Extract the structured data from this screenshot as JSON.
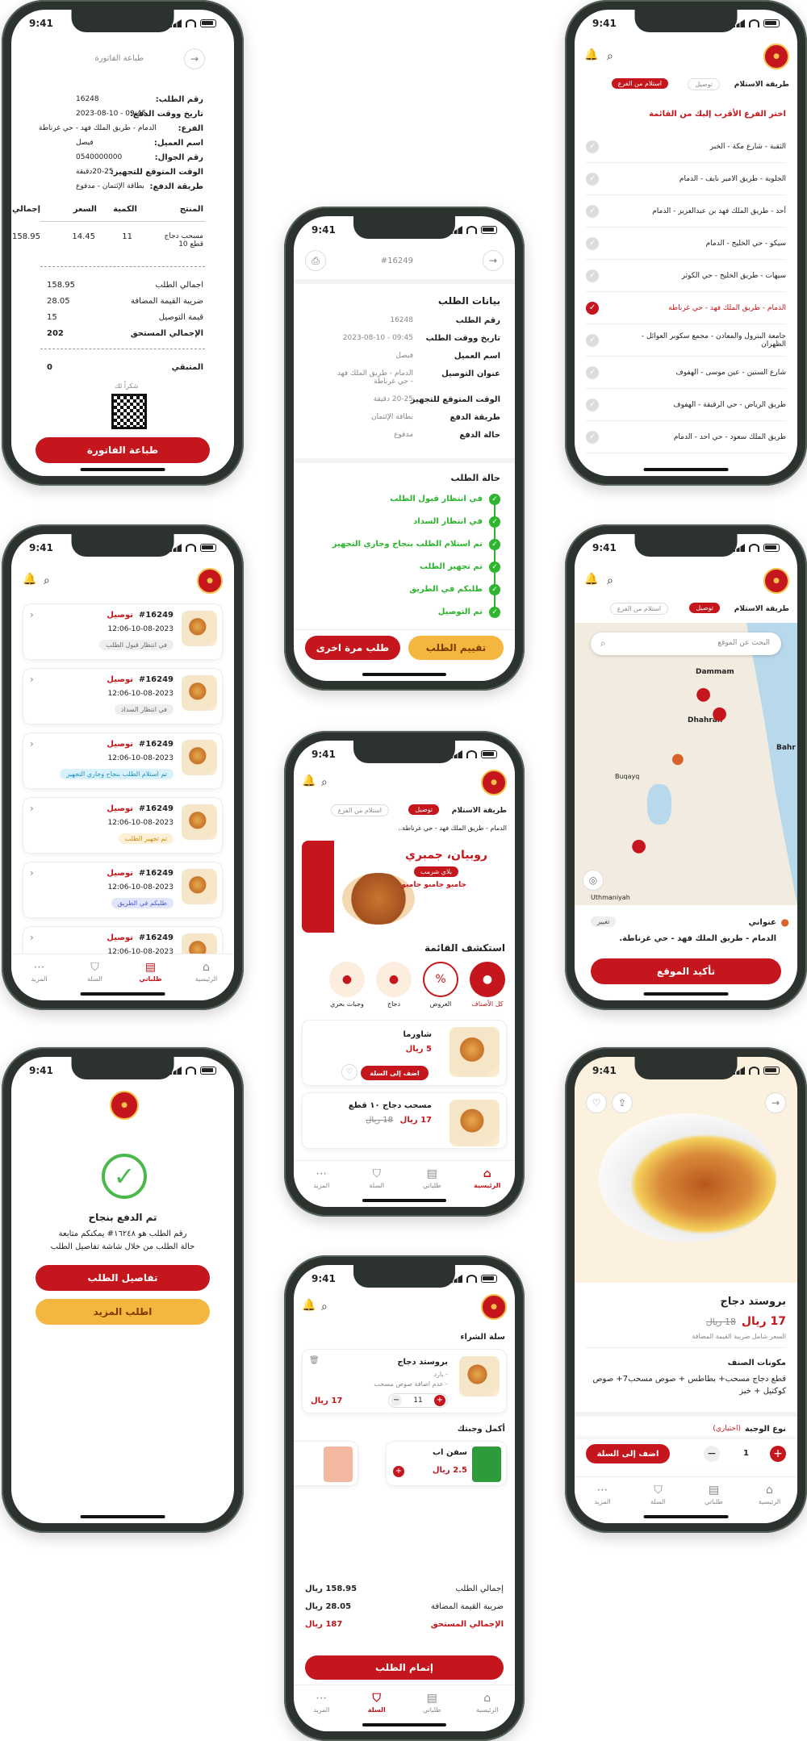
{
  "status": {
    "time": "9:41"
  },
  "invoice": {
    "title": "طباعة الفاتورة",
    "fields": [
      {
        "l": "رقم الطلب:",
        "v": "16248"
      },
      {
        "l": "تاريخ ووقت الدفع:",
        "v": "09:45 - 2023-08-10"
      },
      {
        "l": "الفرع:",
        "v": "الدمام - طريق الملك فهد - حي غرناطة"
      },
      {
        "l": "اسم العميل:",
        "v": "فيصل"
      },
      {
        "l": "رقم الجوال:",
        "v": "0540000000"
      },
      {
        "l": "الوقت المتوقع للتجهيز:",
        "v": "20-25دقيقة"
      },
      {
        "l": "طريقة الدفع:",
        "v": "بطاقة الإئتمان - مدفوع"
      }
    ],
    "cols": [
      "المنتج",
      "الكمية",
      "السعر",
      "إجمالي"
    ],
    "item": {
      "name": "مسحب دجاج قطع 10",
      "qty": "11",
      "price": "14.45",
      "total": "158.95"
    },
    "totals": [
      {
        "l": "اجمالي الطلب",
        "v": "158.95"
      },
      {
        "l": "ضريبة القيمة المضافة",
        "v": "28.05"
      },
      {
        "l": "قيمة التوصيل",
        "v": "15"
      },
      {
        "l": "الإجمالي المستحق",
        "v": "202"
      }
    ],
    "remaining": {
      "l": "المتبقي",
      "v": "0"
    },
    "thanks": "شكراً لك",
    "button": "طباعة الفاتورة"
  },
  "order": {
    "id": "#16249",
    "section": "بيانات الطلب",
    "fields": [
      {
        "l": "رقم الطلب",
        "v": "16248"
      },
      {
        "l": "تاريخ ووقت الطلب",
        "v": "09:45 - 2023-08-10"
      },
      {
        "l": "اسم العميل",
        "v": "فيصل"
      },
      {
        "l": "عنوان التوصيل",
        "v": "الدمام - طريق الملك فهد - حي غرناطة"
      },
      {
        "l": "الوقت المتوقع للتجهيز",
        "v": "20-25 دقيقة"
      },
      {
        "l": "طريقة الدفع",
        "v": "بطاقة الإئتمان"
      },
      {
        "l": "حالة الدفع",
        "v": "مدفوع"
      }
    ],
    "status_title": "حالة الطلب",
    "steps": [
      "في انتظار قبول الطلب",
      "في انتظار السداد",
      "تم استلام الطلب بنجاح وجاري التجهيز",
      "تم تجهيز الطلب",
      "طلبكم في الطريق",
      "تم التوصيل"
    ],
    "rate": "تقييم الطلب",
    "again": "طلب مرة اخرى"
  },
  "branches": {
    "method_label": "طريقة الاستلام",
    "delivery": "توصيل",
    "pickup": "استلام من الفرع",
    "prompt": "اختر الفرع الأقرب إليك من القائمة",
    "list": [
      "الثقبة - شارع مكة - الخبر",
      "الجلوية - طريق الامير نايف - الدمام",
      "أحد - طريق الملك فهد بن عبدالعزيز - الدمام",
      "سيكو - حي الخليج - الدمام",
      "سيهات - طريق الخليج - حي الكوثر",
      "الدمام - طريق الملك فهد - حي غرناطة",
      "جامعة البترول والمعادن - مجمع سكوبر العوائل - الظهران",
      "شارع الستين - عين موسى - الهفوف",
      "طريق الرياض - حي الرقيقة - الهفوف",
      "طريق الملك سعود - حي احد - الدمام"
    ],
    "selected": 5
  },
  "orders": {
    "items": [
      {
        "id": "#16249",
        "type": "توصيل",
        "date": "12:06-10-08-2023",
        "status": "في انتظار قبول الطلب",
        "color": "#eee",
        "fg": "#666"
      },
      {
        "id": "#16249",
        "type": "توصيل",
        "date": "12:06-10-08-2023",
        "status": "في انتظار السداد",
        "color": "#eee",
        "fg": "#666"
      },
      {
        "id": "#16249",
        "type": "توصيل",
        "date": "12:06-10-08-2023",
        "status": "تم استلام الطلب بنجاح وجاري التجهيز",
        "color": "#d9f1fb",
        "fg": "#1a8fc0"
      },
      {
        "id": "#16249",
        "type": "توصيل",
        "date": "12:06-10-08-2023",
        "status": "تم تجهيز الطلب",
        "color": "#fdf0d4",
        "fg": "#c98a12"
      },
      {
        "id": "#16249",
        "type": "توصيل",
        "date": "12:06-10-08-2023",
        "status": "طلبكم في الطريق",
        "color": "#e2e6fb",
        "fg": "#4a5ad6"
      },
      {
        "id": "#16249",
        "type": "توصيل",
        "date": "12:06-10-08-2023",
        "status": "",
        "color": "",
        "fg": ""
      }
    ]
  },
  "tabs": [
    "الرئيسية",
    "طلباتي",
    "السلة",
    "المزيد"
  ],
  "map": {
    "search": "البحث عن الموقع",
    "address_label": "عنواني",
    "change": "تغيير",
    "address": "الدمام - طريق الملك فهد - حي غرناطة.",
    "confirm": "تأكيد الموقع",
    "labels": [
      "Dammam",
      "Dhahran",
      "Bahr",
      "Buqayq",
      "Uthmaniyah"
    ]
  },
  "home": {
    "address": "الدمام - طريق الملك فهد - حي غرناطة..",
    "banner": {
      "t1": "روبيان، جمبري",
      "t2": "بلاي شرمب",
      "t3": "جامبو جامبو جامبو"
    },
    "menu_title": "استكشف القائمة",
    "cats": [
      "كل الأصناف",
      "العروض",
      "دجاج",
      "وجبات بحري"
    ],
    "products": [
      {
        "name": "شاورما",
        "price": "5 ريال",
        "add": "اضف إلى السلة"
      },
      {
        "name": "مسحب دجاج ١٠ قطع",
        "price": "17 ريال",
        "old": "18 ريال"
      }
    ]
  },
  "success": {
    "title": "تم الدفع بنجاح",
    "msg1": "رقم الطلب هو ١٦٢٤٨# يمكنكم متابعة",
    "msg2": "حالة الطلب من خلال شاشة تفاصيل الطلب",
    "details": "تفاصيل الطلب",
    "more": "اطلب المزيد"
  },
  "cart": {
    "title": "سلة الشراء",
    "item": {
      "name": "بروستد دجاج",
      "sub1": "- بارد",
      "sub2": "- عدم اضافة صوص مسحب",
      "qty": "11",
      "price": "17 ريال"
    },
    "complete": "أكمل وجبتك",
    "upsell": [
      {
        "name": "سفن اب",
        "price": "2.5 ريال"
      }
    ],
    "totals": [
      {
        "l": "إجمالي الطلب",
        "v": "158.95 ريال"
      },
      {
        "l": "ضريبة القيمة المضافة",
        "v": "28.05 ريال"
      },
      {
        "l": "الإجمالي المستحق",
        "v": "187 ريال"
      }
    ],
    "checkout": "إتمام الطلب"
  },
  "product": {
    "name": "بروستد دجاج",
    "price": "17 ريال",
    "old": "18 ريال",
    "note": "السعر شامل ضريبة القيمة المضافة",
    "ing_title": "مكونات الصنف",
    "ing": "قطع دجاج مسحب+ بطاطس + صوص مسحب7+ صوص كوكتيل + خبز",
    "meal": "نوع الوجبة",
    "optional": "(اختياري)",
    "qty": "1",
    "add": "اضف إلى السلة"
  }
}
